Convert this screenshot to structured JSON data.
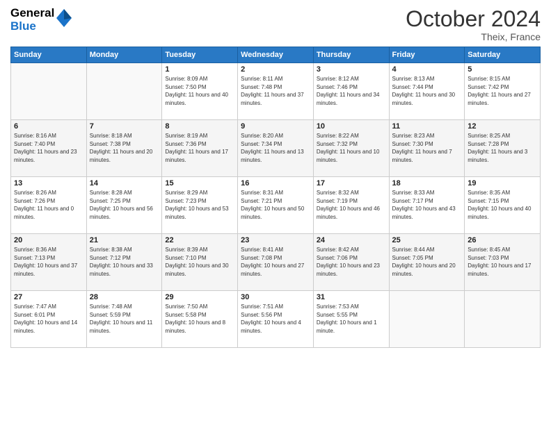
{
  "logo": {
    "line1": "General",
    "line2": "Blue"
  },
  "header": {
    "month": "October 2024",
    "location": "Theix, France"
  },
  "weekdays": [
    "Sunday",
    "Monday",
    "Tuesday",
    "Wednesday",
    "Thursday",
    "Friday",
    "Saturday"
  ],
  "weeks": [
    [
      {
        "day": "",
        "sunrise": "",
        "sunset": "",
        "daylight": ""
      },
      {
        "day": "",
        "sunrise": "",
        "sunset": "",
        "daylight": ""
      },
      {
        "day": "1",
        "sunrise": "Sunrise: 8:09 AM",
        "sunset": "Sunset: 7:50 PM",
        "daylight": "Daylight: 11 hours and 40 minutes."
      },
      {
        "day": "2",
        "sunrise": "Sunrise: 8:11 AM",
        "sunset": "Sunset: 7:48 PM",
        "daylight": "Daylight: 11 hours and 37 minutes."
      },
      {
        "day": "3",
        "sunrise": "Sunrise: 8:12 AM",
        "sunset": "Sunset: 7:46 PM",
        "daylight": "Daylight: 11 hours and 34 minutes."
      },
      {
        "day": "4",
        "sunrise": "Sunrise: 8:13 AM",
        "sunset": "Sunset: 7:44 PM",
        "daylight": "Daylight: 11 hours and 30 minutes."
      },
      {
        "day": "5",
        "sunrise": "Sunrise: 8:15 AM",
        "sunset": "Sunset: 7:42 PM",
        "daylight": "Daylight: 11 hours and 27 minutes."
      }
    ],
    [
      {
        "day": "6",
        "sunrise": "Sunrise: 8:16 AM",
        "sunset": "Sunset: 7:40 PM",
        "daylight": "Daylight: 11 hours and 23 minutes."
      },
      {
        "day": "7",
        "sunrise": "Sunrise: 8:18 AM",
        "sunset": "Sunset: 7:38 PM",
        "daylight": "Daylight: 11 hours and 20 minutes."
      },
      {
        "day": "8",
        "sunrise": "Sunrise: 8:19 AM",
        "sunset": "Sunset: 7:36 PM",
        "daylight": "Daylight: 11 hours and 17 minutes."
      },
      {
        "day": "9",
        "sunrise": "Sunrise: 8:20 AM",
        "sunset": "Sunset: 7:34 PM",
        "daylight": "Daylight: 11 hours and 13 minutes."
      },
      {
        "day": "10",
        "sunrise": "Sunrise: 8:22 AM",
        "sunset": "Sunset: 7:32 PM",
        "daylight": "Daylight: 11 hours and 10 minutes."
      },
      {
        "day": "11",
        "sunrise": "Sunrise: 8:23 AM",
        "sunset": "Sunset: 7:30 PM",
        "daylight": "Daylight: 11 hours and 7 minutes."
      },
      {
        "day": "12",
        "sunrise": "Sunrise: 8:25 AM",
        "sunset": "Sunset: 7:28 PM",
        "daylight": "Daylight: 11 hours and 3 minutes."
      }
    ],
    [
      {
        "day": "13",
        "sunrise": "Sunrise: 8:26 AM",
        "sunset": "Sunset: 7:26 PM",
        "daylight": "Daylight: 11 hours and 0 minutes."
      },
      {
        "day": "14",
        "sunrise": "Sunrise: 8:28 AM",
        "sunset": "Sunset: 7:25 PM",
        "daylight": "Daylight: 10 hours and 56 minutes."
      },
      {
        "day": "15",
        "sunrise": "Sunrise: 8:29 AM",
        "sunset": "Sunset: 7:23 PM",
        "daylight": "Daylight: 10 hours and 53 minutes."
      },
      {
        "day": "16",
        "sunrise": "Sunrise: 8:31 AM",
        "sunset": "Sunset: 7:21 PM",
        "daylight": "Daylight: 10 hours and 50 minutes."
      },
      {
        "day": "17",
        "sunrise": "Sunrise: 8:32 AM",
        "sunset": "Sunset: 7:19 PM",
        "daylight": "Daylight: 10 hours and 46 minutes."
      },
      {
        "day": "18",
        "sunrise": "Sunrise: 8:33 AM",
        "sunset": "Sunset: 7:17 PM",
        "daylight": "Daylight: 10 hours and 43 minutes."
      },
      {
        "day": "19",
        "sunrise": "Sunrise: 8:35 AM",
        "sunset": "Sunset: 7:15 PM",
        "daylight": "Daylight: 10 hours and 40 minutes."
      }
    ],
    [
      {
        "day": "20",
        "sunrise": "Sunrise: 8:36 AM",
        "sunset": "Sunset: 7:13 PM",
        "daylight": "Daylight: 10 hours and 37 minutes."
      },
      {
        "day": "21",
        "sunrise": "Sunrise: 8:38 AM",
        "sunset": "Sunset: 7:12 PM",
        "daylight": "Daylight: 10 hours and 33 minutes."
      },
      {
        "day": "22",
        "sunrise": "Sunrise: 8:39 AM",
        "sunset": "Sunset: 7:10 PM",
        "daylight": "Daylight: 10 hours and 30 minutes."
      },
      {
        "day": "23",
        "sunrise": "Sunrise: 8:41 AM",
        "sunset": "Sunset: 7:08 PM",
        "daylight": "Daylight: 10 hours and 27 minutes."
      },
      {
        "day": "24",
        "sunrise": "Sunrise: 8:42 AM",
        "sunset": "Sunset: 7:06 PM",
        "daylight": "Daylight: 10 hours and 23 minutes."
      },
      {
        "day": "25",
        "sunrise": "Sunrise: 8:44 AM",
        "sunset": "Sunset: 7:05 PM",
        "daylight": "Daylight: 10 hours and 20 minutes."
      },
      {
        "day": "26",
        "sunrise": "Sunrise: 8:45 AM",
        "sunset": "Sunset: 7:03 PM",
        "daylight": "Daylight: 10 hours and 17 minutes."
      }
    ],
    [
      {
        "day": "27",
        "sunrise": "Sunrise: 7:47 AM",
        "sunset": "Sunset: 6:01 PM",
        "daylight": "Daylight: 10 hours and 14 minutes."
      },
      {
        "day": "28",
        "sunrise": "Sunrise: 7:48 AM",
        "sunset": "Sunset: 5:59 PM",
        "daylight": "Daylight: 10 hours and 11 minutes."
      },
      {
        "day": "29",
        "sunrise": "Sunrise: 7:50 AM",
        "sunset": "Sunset: 5:58 PM",
        "daylight": "Daylight: 10 hours and 8 minutes."
      },
      {
        "day": "30",
        "sunrise": "Sunrise: 7:51 AM",
        "sunset": "Sunset: 5:56 PM",
        "daylight": "Daylight: 10 hours and 4 minutes."
      },
      {
        "day": "31",
        "sunrise": "Sunrise: 7:53 AM",
        "sunset": "Sunset: 5:55 PM",
        "daylight": "Daylight: 10 hours and 1 minute."
      },
      {
        "day": "",
        "sunrise": "",
        "sunset": "",
        "daylight": ""
      },
      {
        "day": "",
        "sunrise": "",
        "sunset": "",
        "daylight": ""
      }
    ]
  ]
}
